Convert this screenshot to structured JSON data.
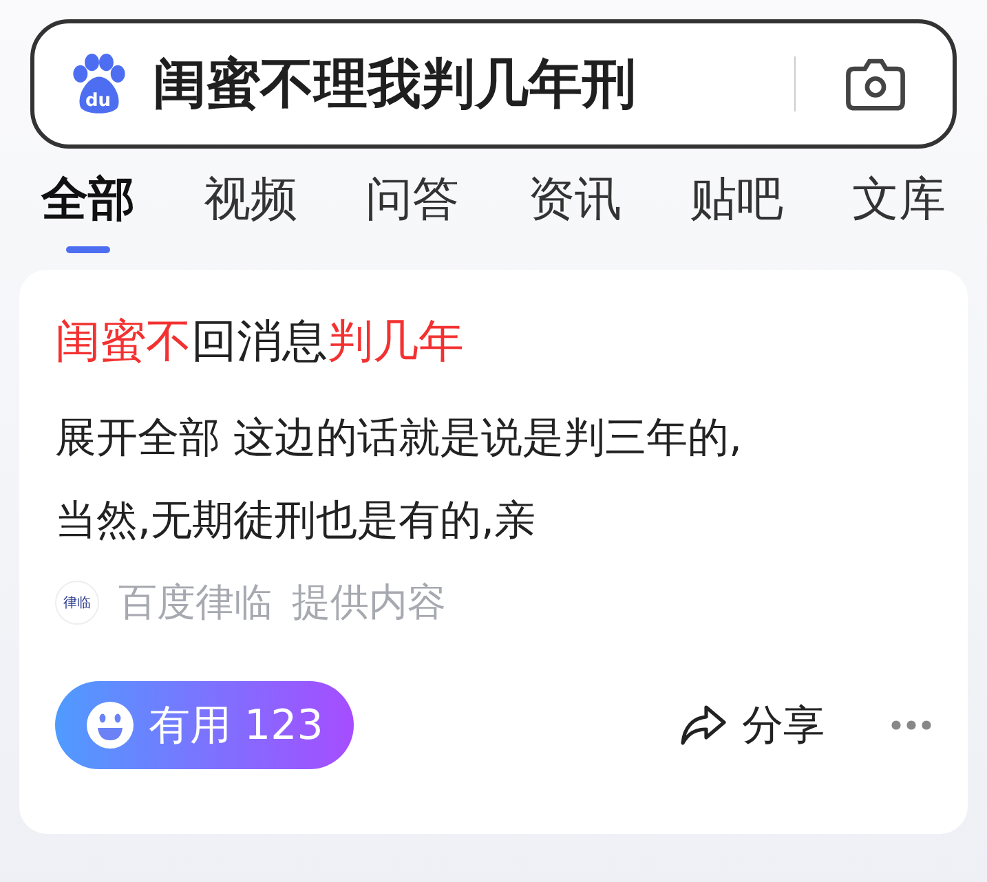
{
  "search": {
    "logo_text": "du",
    "query": "闺蜜不理我判几年刑"
  },
  "tabs": [
    {
      "label": "全部",
      "selected": true
    },
    {
      "label": "视频",
      "selected": false
    },
    {
      "label": "问答",
      "selected": false
    },
    {
      "label": "资讯",
      "selected": false
    },
    {
      "label": "贴吧",
      "selected": false
    },
    {
      "label": "文库",
      "selected": false
    }
  ],
  "result": {
    "title": [
      {
        "text": "闺蜜不",
        "highlight": true
      },
      {
        "text": "回消息",
        "highlight": false
      },
      {
        "text": "判几年",
        "highlight": true
      }
    ],
    "body": "展开全部 这边的话就是说是判三年的,当然,无期徒刑也是有的,亲",
    "source": {
      "badge": "律临",
      "name": "百度律临",
      "note": "提供内容"
    },
    "useful": {
      "label": "有用 123"
    },
    "share": {
      "label": "分享"
    }
  }
}
